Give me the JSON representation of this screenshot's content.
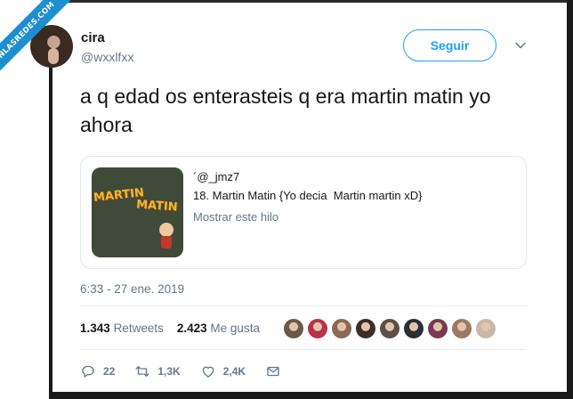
{
  "watermark": {
    "text": "VISTOENLASREDES.COM"
  },
  "user": {
    "name": "cira",
    "handle": "@wxxlfxx"
  },
  "follow_button": {
    "label": "Seguir"
  },
  "tweet": {
    "text": "a q edad os enterasteis q era martin matin yo ahora"
  },
  "quote": {
    "handle": "´@_jmz7",
    "body": "18. Martin Matin {Yo decia  Martin martin xD}",
    "thread_link": "Mostrar este hilo",
    "thumbnail_text": [
      "MARTIN",
      "MATIN"
    ]
  },
  "timestamp": "6:33 - 27 ene. 2019",
  "stats": {
    "retweets_count": "1.343",
    "retweets_label": "Retweets",
    "likes_count": "2.423",
    "likes_label": "Me gusta"
  },
  "likers_colors": [
    "#6b5a4a",
    "#b8324a",
    "#8a6a55",
    "#3b2e2a",
    "#5a5048",
    "#2a2f3a",
    "#7a3a52",
    "#9a7a62",
    "#c9b8a8"
  ],
  "actions": {
    "replies": "22",
    "retweets": "1,3K",
    "likes": "2,4K"
  },
  "colors": {
    "accent": "#1da1f2",
    "secondary_text": "#657786",
    "watermark_ribbon": "#1d8ecf"
  }
}
